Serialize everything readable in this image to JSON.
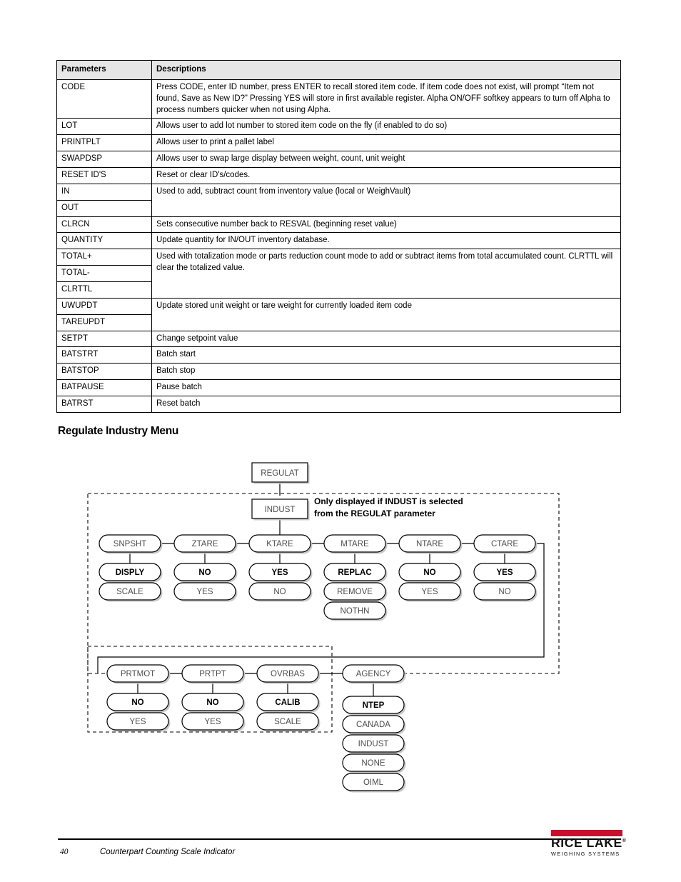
{
  "table": {
    "headers": [
      "Parameters",
      "Descriptions"
    ],
    "rows": [
      {
        "param": "CODE",
        "desc": "Press CODE, enter ID number, press ENTER to recall stored item code.  If item code does not exist, will prompt “Item not found, Save as New ID?”  Pressing YES will store in first available register. Alpha ON/OFF softkey appears to turn off Alpha to process numbers quicker when not using Alpha.",
        "indent": false
      },
      {
        "param": "LOT",
        "desc": "Allows user to add lot number to stored item code on the fly (if enabled to do so)",
        "indent": true
      },
      {
        "param": "PRINTPLT",
        "desc": "Allows user to print a pallet label",
        "indent": true
      },
      {
        "param": "SWAPDSP",
        "desc": "Allows user to swap large display between weight, count, unit weight",
        "indent": true
      },
      {
        "param": "RESET ID'S",
        "desc": "Reset or clear ID's/codes.",
        "indent": false
      },
      {
        "param": "IN",
        "desc": "Used to add, subtract count from inventory value (local or WeighVault)",
        "indent": false,
        "span": 2
      },
      {
        "param": "OUT",
        "desc": "",
        "indent": false,
        "merged": true
      },
      {
        "param": "CLRCN",
        "desc": "Sets consecutive number back to RESVAL (beginning reset value)",
        "indent": false
      },
      {
        "param": "QUANTITY",
        "desc": "Update quantity for IN/OUT inventory database.",
        "indent": false
      },
      {
        "param": "TOTAL+",
        "desc": "Used with totalization mode or parts reduction count mode to add or subtract items from total accumulated count.  CLRTTL will clear the totalized value.",
        "indent": false,
        "span": 3
      },
      {
        "param": "TOTAL-",
        "desc": "",
        "indent": false,
        "merged": true
      },
      {
        "param": "CLRTTL",
        "desc": "",
        "indent": false,
        "merged": true
      },
      {
        "param": "UWUPDT",
        "desc": "Update stored unit weight or tare weight for currently loaded item code",
        "indent": false,
        "span": 2
      },
      {
        "param": "TAREUPDT",
        "desc": "",
        "indent": false,
        "merged": true
      },
      {
        "param": "SETPT",
        "desc": "Change setpoint value",
        "indent": false
      },
      {
        "param": "BATSTRT",
        "desc": "Batch start",
        "indent": false
      },
      {
        "param": "BATSTOP",
        "desc": "Batch stop",
        "indent": false
      },
      {
        "param": "BATPAUSE",
        "desc": "Pause batch",
        "indent": false
      },
      {
        "param": "BATRST",
        "desc": "Reset batch",
        "indent": false
      }
    ]
  },
  "section": {
    "heading": "Regulate Industry Menu"
  },
  "diagram": {
    "note": {
      "line1": "Only displayed if INDUST is selected",
      "line2": "from the REGULAT parameter"
    },
    "root": "REGULAT",
    "indust": "INDUST",
    "row1": [
      {
        "name": "SNPSHT",
        "options": [
          "DISPLY",
          "SCALE"
        ]
      },
      {
        "name": "ZTARE",
        "options": [
          "NO",
          "YES"
        ]
      },
      {
        "name": "KTARE",
        "options": [
          "YES",
          "NO"
        ]
      },
      {
        "name": "MTARE",
        "options": [
          "REPLAC",
          "REMOVE",
          "NOTHN"
        ]
      },
      {
        "name": "NTARE",
        "options": [
          "NO",
          "YES"
        ]
      },
      {
        "name": "CTARE",
        "options": [
          "YES",
          "NO"
        ]
      }
    ],
    "row2": [
      {
        "name": "PRTMOT",
        "options": [
          "NO",
          "YES"
        ]
      },
      {
        "name": "PRTPT",
        "options": [
          "NO",
          "YES"
        ]
      },
      {
        "name": "OVRBAS",
        "options": [
          "CALIB",
          "SCALE"
        ]
      },
      {
        "name": "AGENCY",
        "options": [
          "NTEP",
          "CANADA",
          "INDUST",
          "NONE",
          "OIML"
        ]
      }
    ]
  },
  "footer": {
    "page": "40",
    "title": "Counterpart Counting Scale Indicator",
    "logo_name": "RICE LAKE",
    "logo_tagline": "WEIGHING SYSTEMS"
  },
  "colors": {
    "brand_red": "#c8102e",
    "header_gray": "#e6e6e6",
    "node_text": "#4d4d4d"
  }
}
